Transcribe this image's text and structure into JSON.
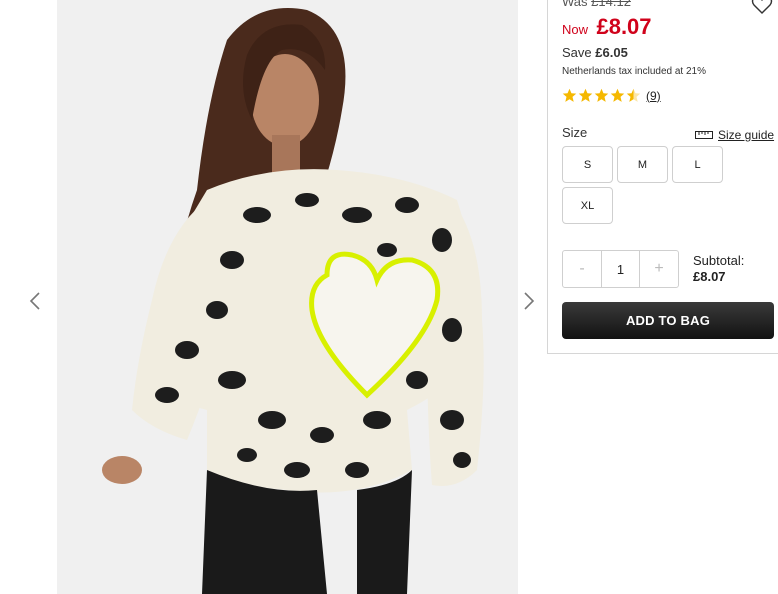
{
  "gallery": {
    "prev_icon": "chevron-left-icon",
    "next_icon": "chevron-right-icon",
    "image_alt": "Model wearing cream leopard print knitted jumper with neon heart"
  },
  "product": {
    "was_label": "Was",
    "was_price": "£14.12",
    "now_label": "Now",
    "now_price": "£8.07",
    "save_label": "Save",
    "save_amount": "£6.05",
    "tax_note": "Netherlands tax included at 21%",
    "rating_value": 4.5,
    "review_count": "(9)",
    "wishlist_icon": "heart-outline-icon",
    "price_color": "#d0021b"
  },
  "size": {
    "label": "Size",
    "guide_label": "Size guide",
    "guide_icon": "ruler-icon",
    "options": [
      "S",
      "M",
      "L",
      "XL"
    ]
  },
  "quantity": {
    "minus": "-",
    "value": "1",
    "plus": "+"
  },
  "subtotal": {
    "label": "Subtotal:",
    "amount": "£8.07"
  },
  "cta": {
    "add_to_bag": "ADD TO BAG"
  }
}
